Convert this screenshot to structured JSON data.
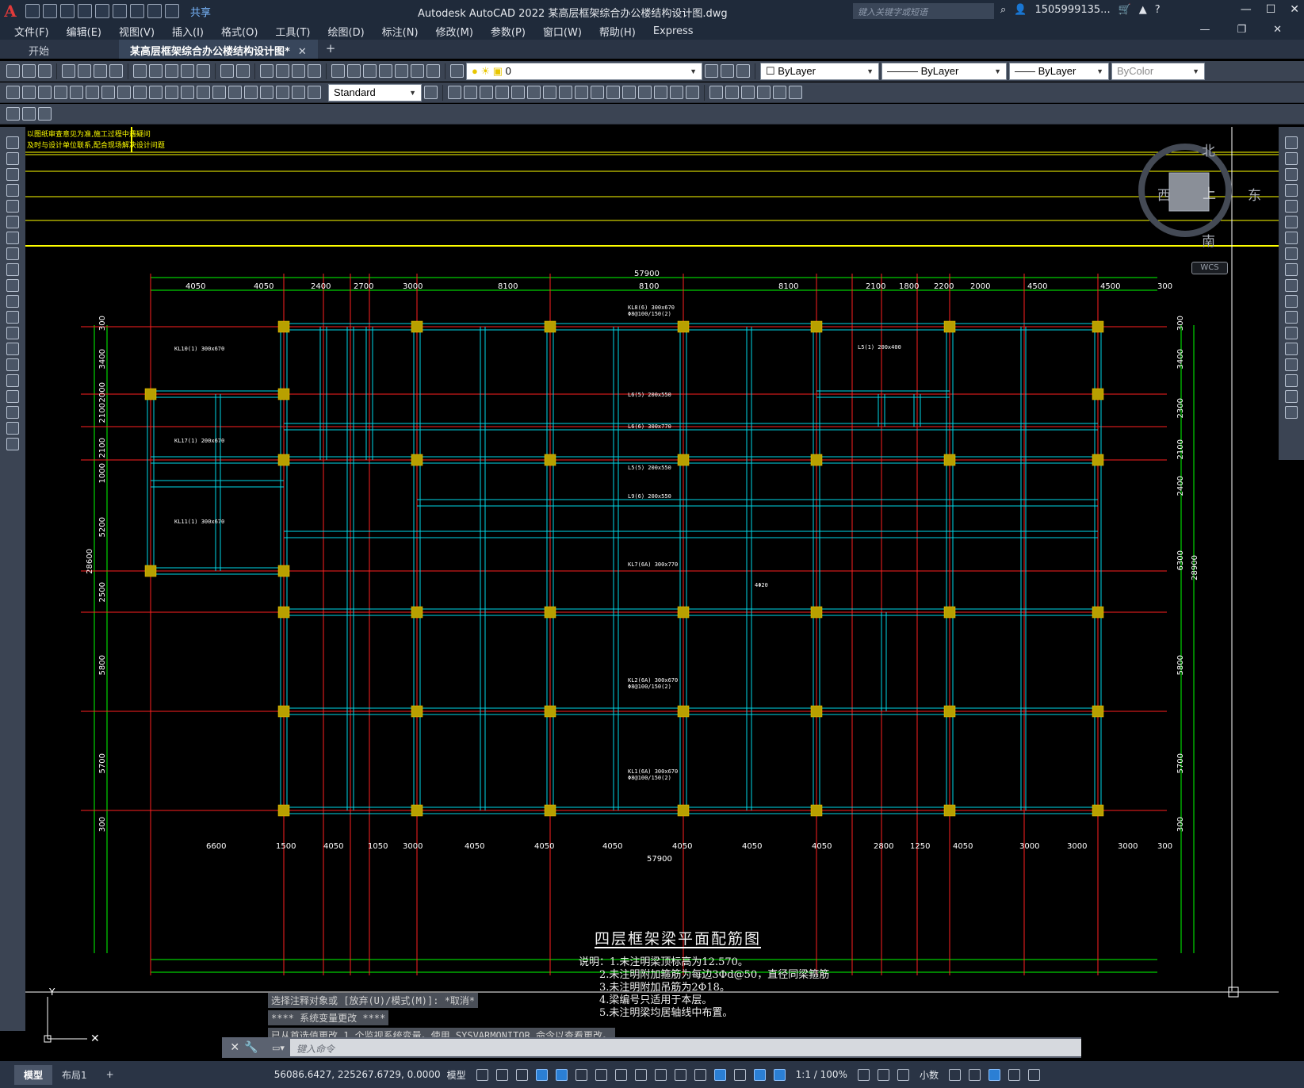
{
  "app": {
    "logo": "A",
    "share_label": "共享",
    "title": "Autodesk AutoCAD 2022    某高层框架综合办公楼结构设计图.dwg",
    "search_placeholder": "键入关键字或短语",
    "user": "1505999135...",
    "help": "?"
  },
  "menu": [
    "文件(F)",
    "编辑(E)",
    "视图(V)",
    "插入(I)",
    "格式(O)",
    "工具(T)",
    "绘图(D)",
    "标注(N)",
    "修改(M)",
    "参数(P)",
    "窗口(W)",
    "帮助(H)",
    "Express"
  ],
  "tabs": {
    "start": "开始",
    "active": "某高层框架综合办公楼结构设计图*",
    "close": "✕",
    "add": "+"
  },
  "toolbar": {
    "layer_value": "0",
    "color_value": "ByLayer",
    "linetype_value": "ByLayer",
    "lineweight_value": "ByLayer",
    "plotstyle_value": "ByColor",
    "textstyle_value": "Standard"
  },
  "viewcube": {
    "north": "北",
    "south": "南",
    "east": "东",
    "west": "西",
    "top": "上",
    "wcs": "WCS"
  },
  "drawing": {
    "title": "四层框架梁平面配筋图",
    "notes": [
      "说明：1.未注明梁顶标高为12.570。",
      "2.未注明附加箍筋为每边3Φd@50，直径同梁箍筋",
      "3.未注明附加吊筋为2Φ18。",
      "4.梁编号只适用于本层。",
      "5.未注明梁均居轴线中布置。"
    ],
    "top_overall": "57900",
    "top_dims": [
      "4050",
      "4050",
      "2400",
      "2700",
      "3000",
      "8100",
      "8100",
      "8100",
      "2100",
      "1800",
      "2200",
      "2000",
      "4500",
      "4500",
      "300"
    ],
    "bottom_overall": "57900",
    "bottom_dims": [
      "6600",
      "1500",
      "4050",
      "1050",
      "3000",
      "4050",
      "4050",
      "4050",
      "4050",
      "4050",
      "4050",
      "2800",
      "1250",
      "4050",
      "3000",
      "3000",
      "3000",
      "300"
    ],
    "left_overall": "28600",
    "left_dims": [
      "300",
      "3400",
      "2000",
      "2100",
      "2100",
      "1000",
      "5200",
      "2500",
      "5800",
      "5700",
      "300"
    ],
    "right_overall": "28900",
    "right_dims": [
      "300",
      "3400",
      "2300",
      "2100",
      "2400",
      "6300",
      "5800",
      "5700",
      "300"
    ],
    "corner_note": [
      "以图纸审查意见为准,施工过程中遇疑问",
      "及时与设计单位联系,配合现场解决设计问题"
    ]
  },
  "command": {
    "history": [
      "选择注释对象或 [放弃(U)/模式(M)]: *取消*",
      "**** 系统变量更改 ****",
      "已从首选值更改 1 个监视系统变量。使用 SYSVARMONITOR 命令以查看更改。"
    ],
    "placeholder": "键入命令"
  },
  "status": {
    "model_tab": "模型",
    "layout_tab": "布局1",
    "add": "+",
    "coords": "56086.6427, 225267.6729, 0.0000",
    "space": "模型",
    "scale": "1:1 / 100%",
    "units": "小数"
  }
}
